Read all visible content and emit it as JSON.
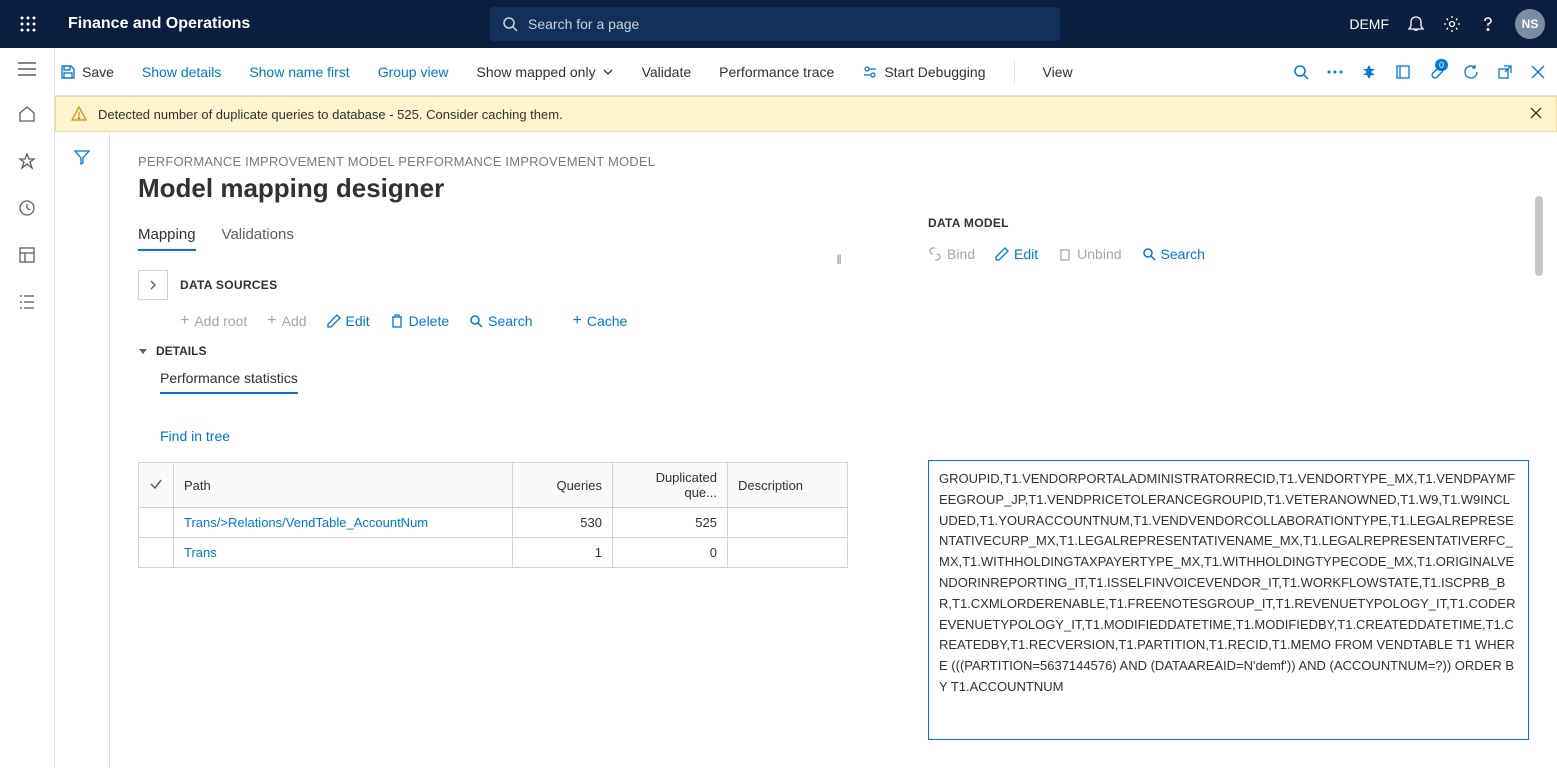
{
  "header": {
    "app_title": "Finance and Operations",
    "search_placeholder": "Search for a page",
    "company": "DEMF",
    "avatar": "NS"
  },
  "actions": {
    "save": "Save",
    "show_details": "Show details",
    "show_name_first": "Show name first",
    "group_view": "Group view",
    "show_mapped_only": "Show mapped only",
    "validate": "Validate",
    "perf_trace": "Performance trace",
    "start_debug": "Start Debugging",
    "view": "View"
  },
  "warning": "Detected number of duplicate queries to database - 525. Consider caching them.",
  "page": {
    "breadcrumb": "PERFORMANCE IMPROVEMENT MODEL PERFORMANCE IMPROVEMENT MODEL",
    "title": "Model mapping designer"
  },
  "tabs": {
    "mapping": "Mapping",
    "validations": "Validations"
  },
  "data_sources": {
    "title": "DATA SOURCES",
    "add_root": "Add root",
    "add": "Add",
    "edit": "Edit",
    "delete": "Delete",
    "search": "Search",
    "cache": "Cache"
  },
  "details": {
    "title": "DETAILS",
    "perf_stats": "Performance statistics",
    "find_in_tree": "Find in tree"
  },
  "table": {
    "headers": {
      "path": "Path",
      "queries": "Queries",
      "dup": "Duplicated que...",
      "desc": "Description"
    },
    "rows": [
      {
        "path": "Trans/>Relations/VendTable_AccountNum",
        "queries": "530",
        "dup": "525",
        "desc": ""
      },
      {
        "path": "Trans",
        "queries": "1",
        "dup": "0",
        "desc": ""
      }
    ]
  },
  "data_model": {
    "title": "DATA MODEL",
    "bind": "Bind",
    "edit": "Edit",
    "unbind": "Unbind",
    "search": "Search"
  },
  "sql_text": "GROUPID,T1.VENDORPORTALADMINISTRATORRECID,T1.VENDORTYPE_MX,T1.VENDPAYMFEEGROUP_JP,T1.VENDPRICETOLERANCEGROUPID,T1.VETERANOWNED,T1.W9,T1.W9INCLUDED,T1.YOURACCOUNTNUM,T1.VENDVENDORCOLLABORATIONTYPE,T1.LEGALREPRESENTATIVECURP_MX,T1.LEGALREPRESENTATIVENAME_MX,T1.LEGALREPRESENTATIVERFC_MX,T1.WITHHOLDINGTAXPAYERTYPE_MX,T1.WITHHOLDINGTYPECODE_MX,T1.ORIGINALVENDORINREPORTING_IT,T1.ISSELFINVOICEVENDOR_IT,T1.WORKFLOWSTATE,T1.ISCPRB_BR,T1.CXMLORDERENABLE,T1.FREENOTESGROUP_IT,T1.REVENUETYPOLOGY_IT,T1.CODEREVENUETYPOLOGY_IT,T1.MODIFIEDDATETIME,T1.MODIFIEDBY,T1.CREATEDDATETIME,T1.CREATEDBY,T1.RECVERSION,T1.PARTITION,T1.RECID,T1.MEMO FROM VENDTABLE T1 WHERE (((PARTITION=5637144576) AND (DATAAREAID=N'demf')) AND (ACCOUNTNUM=?)) ORDER BY T1.ACCOUNTNUM",
  "attachment_badge": "0"
}
